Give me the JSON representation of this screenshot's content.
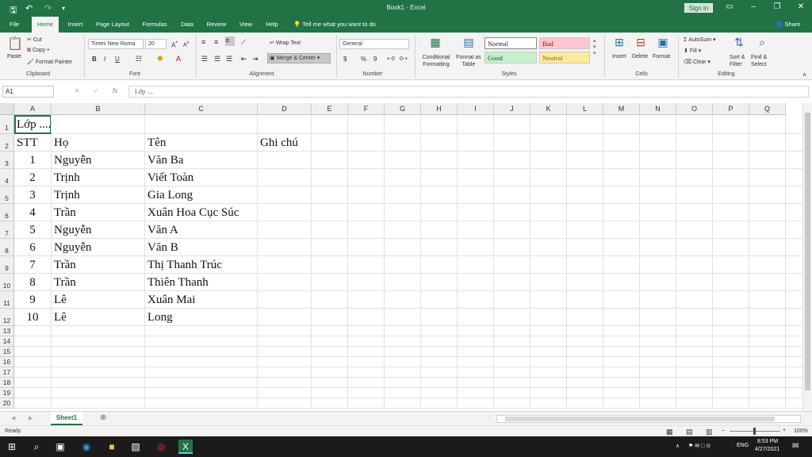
{
  "window": {
    "title": "Book1 - Excel",
    "sign_in": "Sign in"
  },
  "menu": {
    "tabs": [
      "File",
      "Home",
      "Insert",
      "Page Layout",
      "Formulas",
      "Data",
      "Review",
      "View",
      "Help"
    ],
    "tell_me": "Tell me what you want to do",
    "share": "Share"
  },
  "ribbon": {
    "clipboard": {
      "paste": "Paste",
      "cut": "Cut",
      "copy": "Copy",
      "format_painter": "Format Painter",
      "label": "Clipboard"
    },
    "font": {
      "name": "Times New Roma",
      "size": "20",
      "bold": "B",
      "italic": "I",
      "underline": "U",
      "label": "Font"
    },
    "alignment": {
      "wrap_text": "Wrap Text",
      "merge_center": "Merge & Center",
      "label": "Alignment"
    },
    "number": {
      "format": "General",
      "currency": "$",
      "percent": "%",
      "comma": "9",
      "label": "Number"
    },
    "styles": {
      "conditional": "Conditional Formatting",
      "format_table": "Format as Table",
      "normal": "Normal",
      "bad": "Bad",
      "good": "Good",
      "neutral": "Neutral",
      "label": "Styles"
    },
    "cells": {
      "insert": "Insert",
      "delete": "Delete",
      "format": "Format",
      "label": "Cells"
    },
    "editing": {
      "autosum": "AutoSum",
      "fill": "Fill",
      "clear": "Clear",
      "sort_filter": "Sort & Filter",
      "find_select": "Find & Select",
      "label": "Editing"
    }
  },
  "formula_bar": {
    "name_box": "A1",
    "fx": "fx",
    "content": "Lớp ...."
  },
  "columns": [
    "A",
    "B",
    "C",
    "D",
    "E",
    "F",
    "G",
    "H",
    "I",
    "J",
    "K",
    "L",
    "M",
    "N",
    "O",
    "P",
    "Q"
  ],
  "rows": [
    "1",
    "2",
    "3",
    "4",
    "5",
    "6",
    "7",
    "8",
    "9",
    "10",
    "11",
    "12",
    "13",
    "14",
    "15",
    "16",
    "17",
    "18",
    "19",
    "20"
  ],
  "sheet": {
    "a1": "Lớp ....",
    "headers": [
      "STT",
      "Họ",
      "Tên",
      "Ghi chú"
    ],
    "data": [
      [
        "1",
        "Nguyễn",
        "Văn Ba"
      ],
      [
        "2",
        "Trịnh",
        "Viết Toàn"
      ],
      [
        "3",
        "Trịnh",
        "Gia Long"
      ],
      [
        "4",
        "Trần",
        "Xuân Hoa Cục Súc"
      ],
      [
        "5",
        "Nguyễn",
        "Văn A"
      ],
      [
        "6",
        "Nguyễn",
        "Văn B"
      ],
      [
        "7",
        "Trần",
        "Thị Thanh Trúc"
      ],
      [
        "8",
        "Trần",
        "Thiên Thanh"
      ],
      [
        "9",
        "Lê",
        "Xuân Mai"
      ],
      [
        "10",
        "Lê",
        "Long"
      ]
    ]
  },
  "sheet_tabs": {
    "active": "Sheet1"
  },
  "status": {
    "ready": "Ready",
    "zoom": "100%"
  },
  "taskbar": {
    "time": "8:53 PM",
    "date": "4/27/2021",
    "lang": "ENG"
  },
  "colors": {
    "excel_green": "#217346",
    "bad": "#ffc7ce",
    "good": "#c6efce",
    "neutral": "#ffeb9c"
  }
}
